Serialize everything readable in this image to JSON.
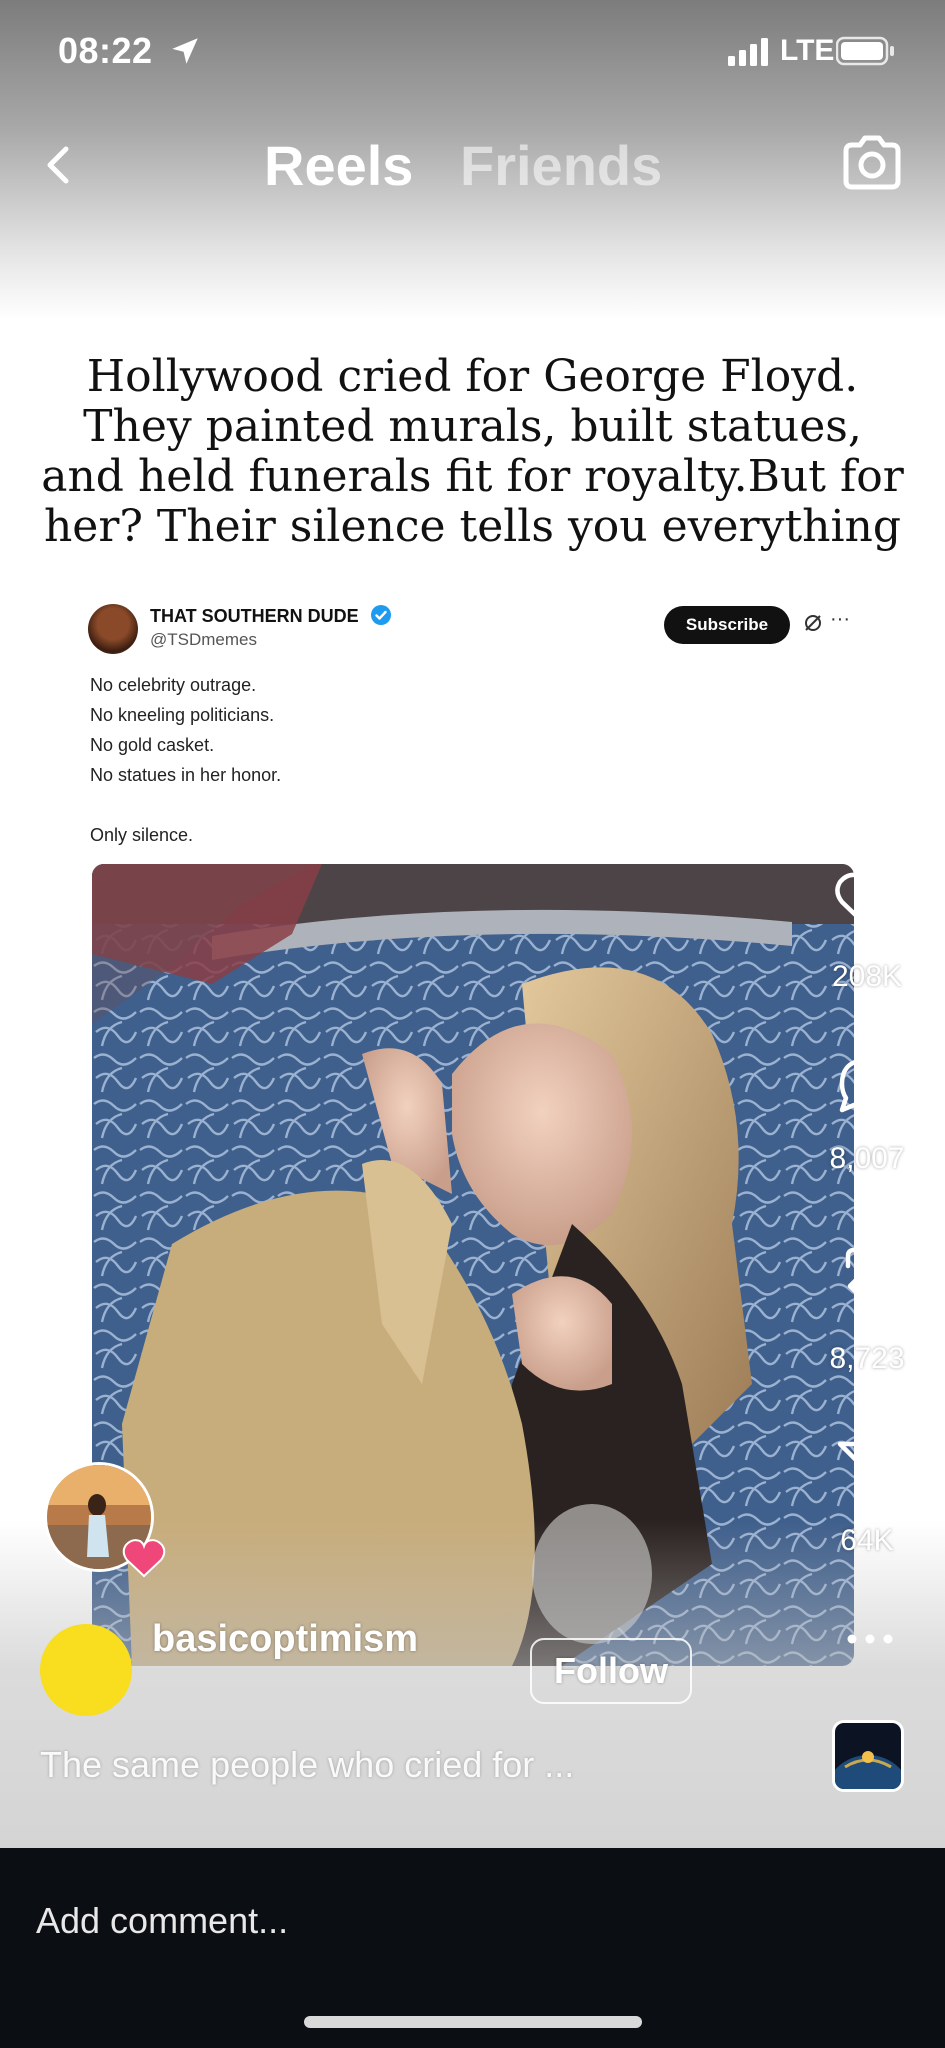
{
  "status_bar": {
    "time": "08:22",
    "carrier": "LTE",
    "location_icon": "location-arrow-icon",
    "signal_icon": "signal-bars-icon",
    "battery_icon": "battery-icon"
  },
  "nav": {
    "tabs": [
      {
        "label": "Reels",
        "active": true
      },
      {
        "label": "Friends",
        "active": false
      }
    ],
    "back_icon": "chevron-left-icon",
    "camera_icon": "camera-icon"
  },
  "post": {
    "headline": "Hollywood cried for George Floyd. They painted murals, built statues, and held funerals fit for royalty.But for her? Their silence tells you everything",
    "tweet": {
      "author": "THAT SOUTHERN DUDE",
      "handle": "@TSDmemes",
      "subscribe_label": "Subscribe",
      "more": "···",
      "lines": [
        "No celebrity outrage.",
        "No kneeling politicians.",
        "No gold casket.",
        "No statues in her honor."
      ],
      "closing_line": "Only silence."
    }
  },
  "actions": {
    "likes": "208K",
    "comments": "8,007",
    "reposts": "8,723",
    "shares": "64K"
  },
  "author": {
    "username": "basicoptimism",
    "follow_label": "Follow",
    "caption": "The same people who cried for ..."
  },
  "comment_bar": {
    "placeholder": "Add comment..."
  },
  "colors": {
    "avatar_yellow": "#f9dd1f",
    "comment_bar_bg": "#0b0f13",
    "verified_blue": "#1d9bf0",
    "heart_badge": "#f0477a"
  }
}
